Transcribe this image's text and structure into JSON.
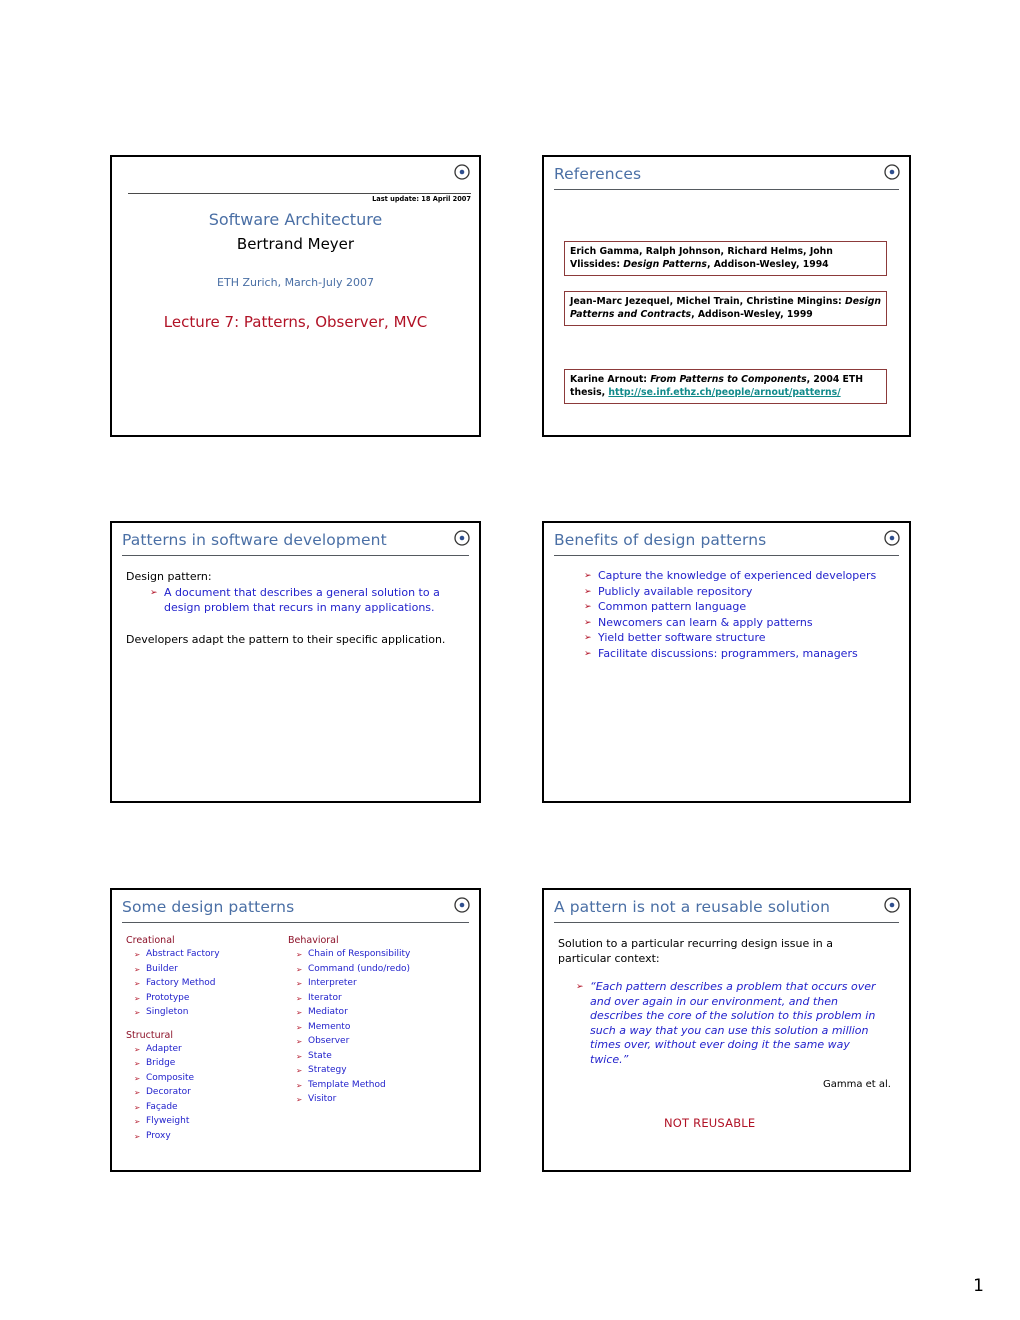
{
  "document": {
    "page_number": "1",
    "slide_corner_icon": "target-dot-icon"
  },
  "colors": {
    "title_blue": "#4a6fa5",
    "bullet_blue": "#2222cc",
    "accent_red": "#b11226",
    "heading_maroon": "#8c1128",
    "link_teal": "#118a8a",
    "box_border": "#8c3a3a"
  },
  "slides": {
    "title_slide": {
      "last_update": "Last update: 18 April 2007",
      "course": "Software Architecture",
      "author": "Bertrand Meyer",
      "venue": "ETH Zurich, March-July 2007",
      "lecture": "Lecture 7: Patterns, Observer, MVC"
    },
    "references": {
      "title": "References",
      "items": [
        {
          "authors": "Erich Gamma, Ralph Johnson, Richard Helms, John Vlissides: ",
          "work": "Design Patterns",
          "rest": ", Addison-Wesley, 1994",
          "link_label": "",
          "style": "upright"
        },
        {
          "authors": "Jean-Marc Jezequel, Michel Train, Christine Mingins: ",
          "work": "Design Patterns and Contracts",
          "rest": ",  Addison-Wesley,  1999",
          "link_label": "",
          "style": "upright"
        },
        {
          "authors": "Karine Arnout: ",
          "work": "From Patterns to Components",
          "rest": ", 2004 ETH thesis, ",
          "link_label": "http://se.inf.ethz.ch/people/arnout/patterns/",
          "style": "upright"
        }
      ]
    },
    "patterns_in_sw_dev": {
      "title": "Patterns in software development",
      "lead": "Design pattern:",
      "bullets": [
        "A document that describes a general solution to a design problem that recurs in many applications."
      ],
      "closing": "Developers adapt the pattern to their specific application."
    },
    "benefits": {
      "title": "Benefits of design patterns",
      "bullets": [
        "Capture the knowledge of experienced developers",
        "Publicly available repository",
        "Common pattern language",
        "Newcomers can learn & apply patterns",
        "Yield better software structure",
        "Facilitate discussions: programmers, managers"
      ]
    },
    "some_design_patterns": {
      "title": "Some design patterns",
      "categories": [
        {
          "name": "Creational",
          "items": [
            "Abstract Factory",
            "Builder",
            "Factory Method",
            "Prototype",
            "Singleton"
          ]
        },
        {
          "name": "Structural",
          "items": [
            "Adapter",
            "Bridge",
            "Composite",
            "Decorator",
            "Façade",
            "Flyweight",
            "Proxy"
          ]
        },
        {
          "name": "Behavioral",
          "items": [
            "Chain of Responsibility",
            "Command (undo/redo)",
            "Interpreter",
            "Iterator",
            "Mediator",
            "Memento",
            "Observer",
            "State",
            "Strategy",
            "Template Method",
            "Visitor"
          ]
        }
      ]
    },
    "not_reusable": {
      "title": "A pattern is not a reusable solution",
      "lead": "Solution to a particular recurring design issue in a particular context:",
      "quote": "“Each pattern describes a problem that occurs over and over again in our environment, and then describes the core of the solution to this problem in such a way that you can use this solution a million times over, without ever doing it the same way twice.”",
      "attribution": "Gamma et al.",
      "stamp": "NOT REUSABLE"
    }
  }
}
